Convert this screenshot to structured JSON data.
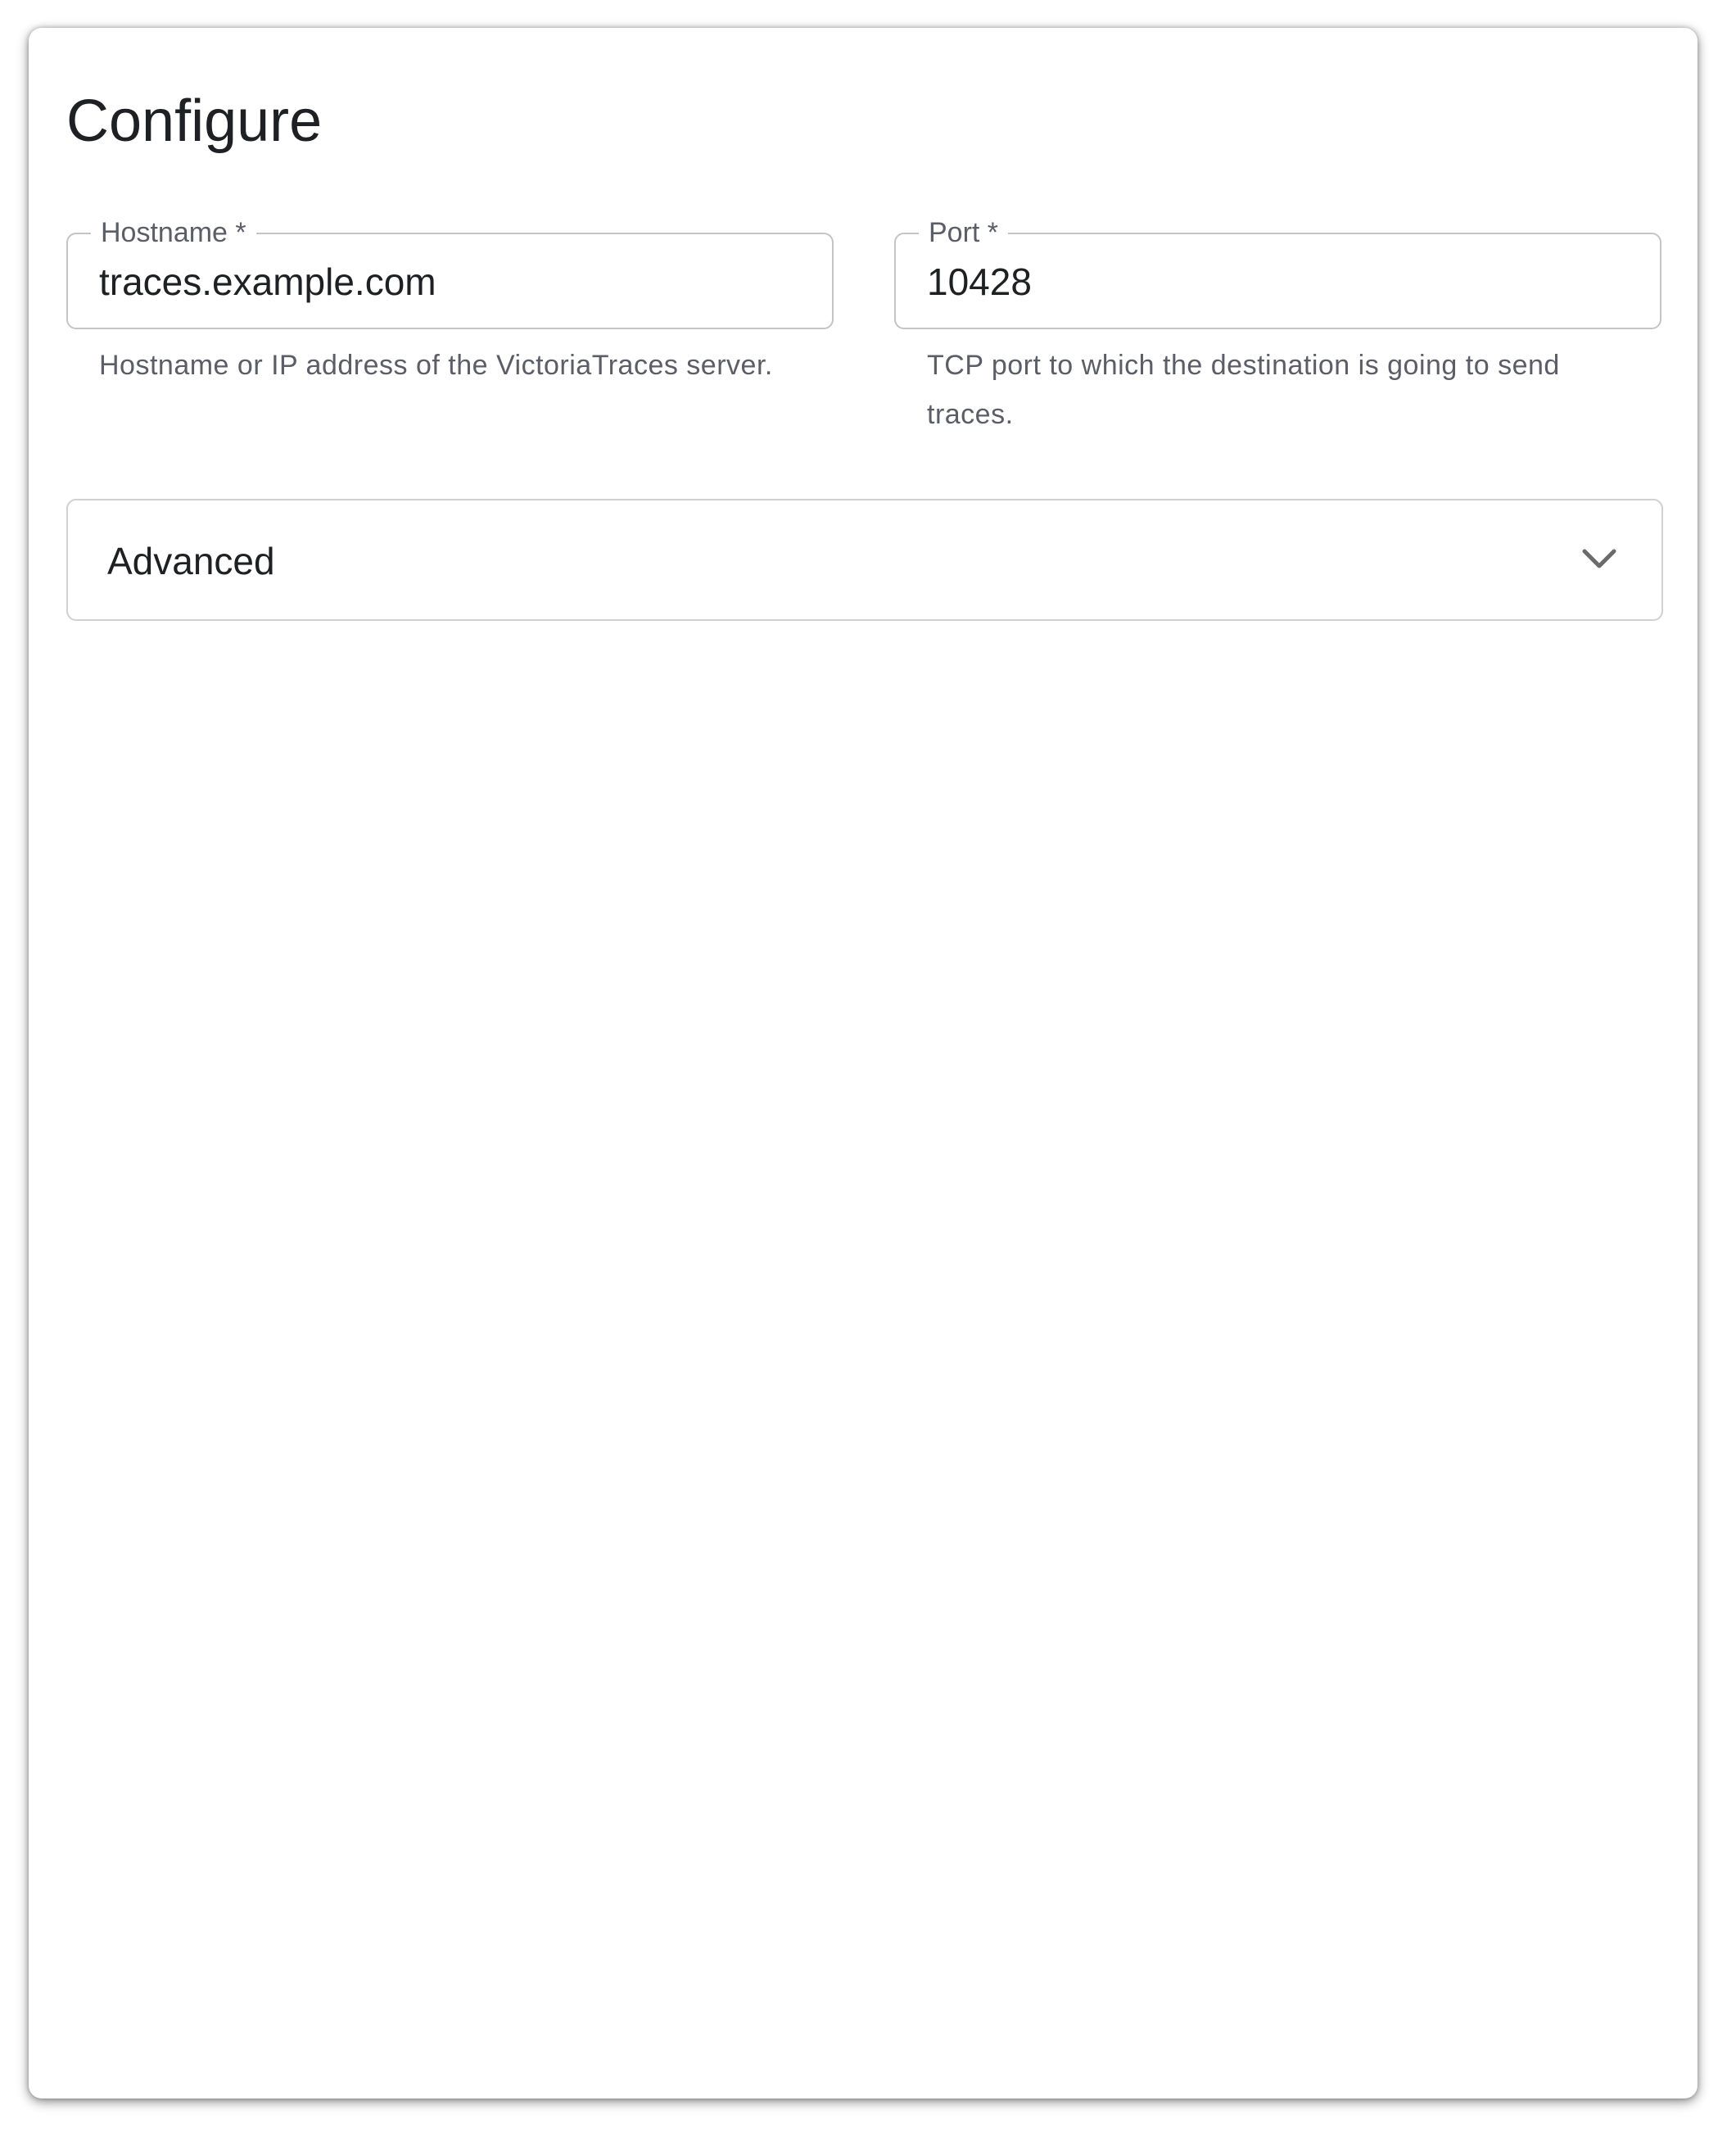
{
  "header": {
    "title": "Configure"
  },
  "form": {
    "hostname": {
      "label": "Hostname *",
      "value": "traces.example.com",
      "helper": "Hostname or IP address of the VictoriaTraces server."
    },
    "port": {
      "label": "Port *",
      "value": "10428",
      "helper": "TCP port to which the destination is going to send traces."
    }
  },
  "advanced": {
    "label": "Advanced",
    "icon": "chevron-down-icon",
    "expanded": false
  },
  "colors": {
    "text_primary": "#1f2023",
    "text_secondary": "#5b5e66",
    "border": "#c4c4c4",
    "icon": "#6b6b6b"
  }
}
